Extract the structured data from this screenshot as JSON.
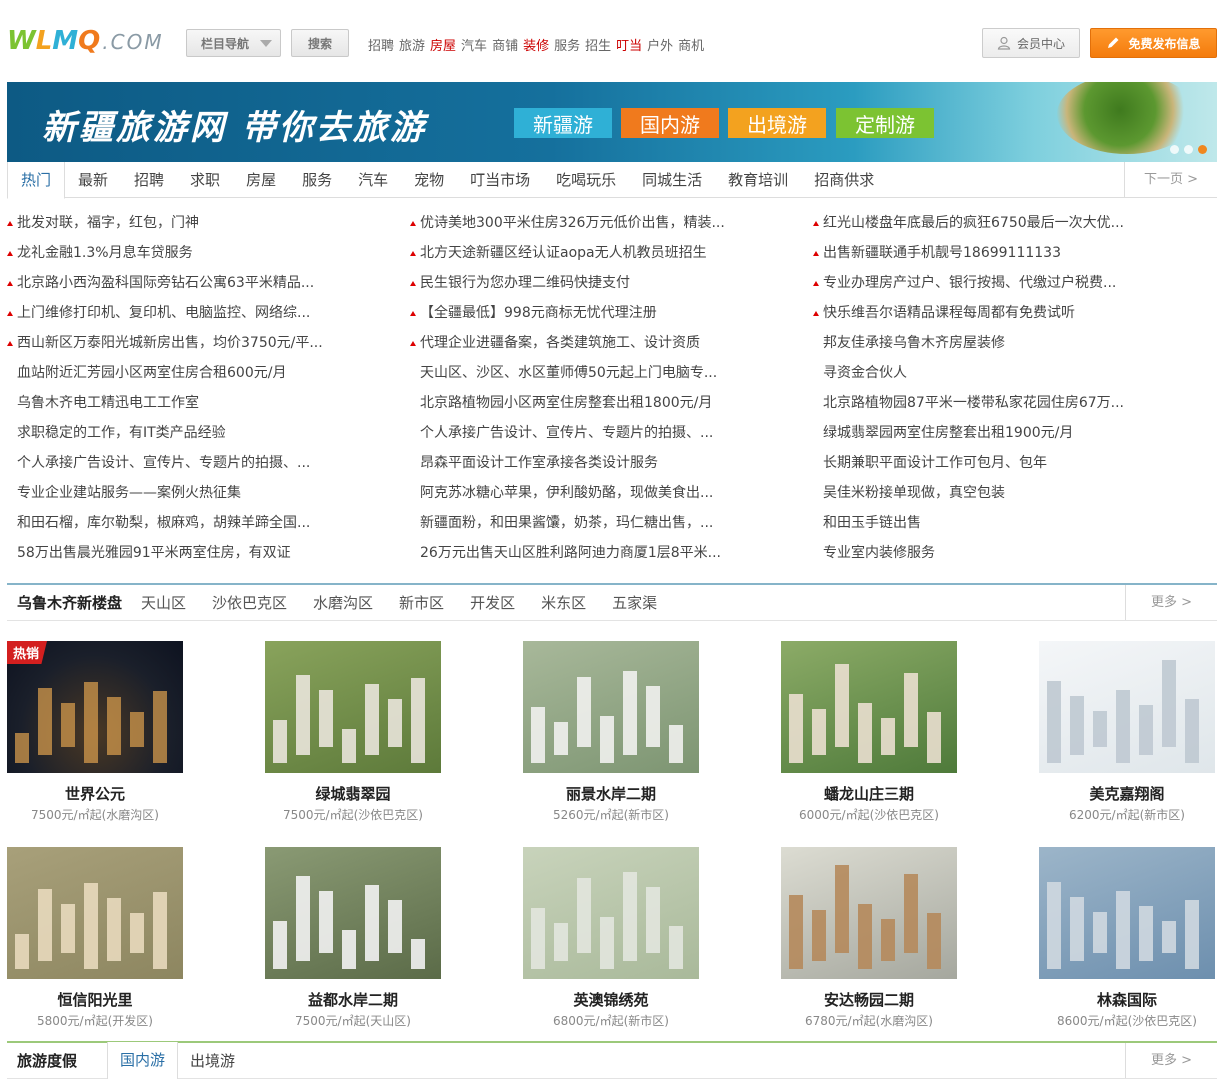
{
  "header": {
    "logo_letters": [
      "W",
      "L",
      "M",
      "Q"
    ],
    "logo_suffix": ".COM",
    "menu_label": "栏目导航",
    "search_label": "搜索",
    "quick_links": [
      {
        "text": "招聘",
        "hl": false
      },
      {
        "text": "旅游",
        "hl": false
      },
      {
        "text": "房屋",
        "hl": true
      },
      {
        "text": "汽车",
        "hl": false
      },
      {
        "text": "商铺",
        "hl": false
      },
      {
        "text": "装修",
        "hl": true
      },
      {
        "text": "服务",
        "hl": false
      },
      {
        "text": "招生",
        "hl": false
      },
      {
        "text": "叮当",
        "hl": true
      },
      {
        "text": "户外",
        "hl": false
      },
      {
        "text": "商机",
        "hl": false
      }
    ],
    "member_label": "会员中心",
    "publish_label": "免费发布信息"
  },
  "banner": {
    "slogan": "新疆旅游网 带你去旅游",
    "tags": [
      "新疆游",
      "国内游",
      "出境游",
      "定制游"
    ],
    "tag_colors": [
      "#2fb0d6",
      "#f07a1d",
      "#f3a21f",
      "#7cc332"
    ]
  },
  "category_tabs": [
    "热门",
    "最新",
    "招聘",
    "求职",
    "房屋",
    "服务",
    "汽车",
    "宠物",
    "叮当市场",
    "吃喝玩乐",
    "同城生活",
    "教育培训",
    "招商供求"
  ],
  "next_page": "下一页 >",
  "listings": [
    {
      "text": "批发对联，福字，红包，门神",
      "hot": true
    },
    {
      "text": "优诗美地300平米住房326万元低价出售，精装...",
      "hot": true
    },
    {
      "text": "红光山楼盘年底最后的疯狂6750最后一次大优...",
      "hot": true
    },
    {
      "text": "龙礼金融1.3%月息车贷服务",
      "hot": true
    },
    {
      "text": "北方天途新疆区经认证aopa无人机教员班招生",
      "hot": true
    },
    {
      "text": "出售新疆联通手机靓号18699111133",
      "hot": true
    },
    {
      "text": "北京路小西沟盈科国际旁钻石公寓63平米精品...",
      "hot": true
    },
    {
      "text": "民生银行为您办理二维码快捷支付",
      "hot": true
    },
    {
      "text": "专业办理房产过户、银行按揭、代缴过户税费...",
      "hot": true
    },
    {
      "text": "上门维修打印机、复印机、电脑监控、网络综...",
      "hot": true
    },
    {
      "text": "【全疆最低】998元商标无忧代理注册",
      "hot": true
    },
    {
      "text": "快乐维吾尔语精品课程每周都有免费试听",
      "hot": true
    },
    {
      "text": "西山新区万泰阳光城新房出售，均价3750元/平...",
      "hot": true
    },
    {
      "text": "代理企业进疆备案，各类建筑施工、设计资质",
      "hot": true
    },
    {
      "text": "邦友佳承接乌鲁木齐房屋装修",
      "hot": false
    },
    {
      "text": "血站附近汇芳园小区两室住房合租600元/月",
      "hot": false
    },
    {
      "text": "天山区、沙区、水区董师傅50元起上门电脑专...",
      "hot": false
    },
    {
      "text": "寻资金合伙人",
      "hot": false
    },
    {
      "text": "乌鲁木齐电工精迅电工工作室",
      "hot": false
    },
    {
      "text": "北京路植物园小区两室住房整套出租1800元/月",
      "hot": false
    },
    {
      "text": "北京路植物园87平米一楼带私家花园住房67万...",
      "hot": false
    },
    {
      "text": "求职稳定的工作，有IT类产品经验",
      "hot": false
    },
    {
      "text": "个人承接广告设计、宣传片、专题片的拍摄、...",
      "hot": false
    },
    {
      "text": "绿城翡翠园两室住房整套出租1900元/月",
      "hot": false
    },
    {
      "text": "个人承接广告设计、宣传片、专题片的拍摄、...",
      "hot": false
    },
    {
      "text": "昂森平面设计工作室承接各类设计服务",
      "hot": false
    },
    {
      "text": "长期兼职平面设计工作可包月、包年",
      "hot": false
    },
    {
      "text": "专业企业建站服务——案例火热征集",
      "hot": false
    },
    {
      "text": "阿克苏冰糖心苹果，伊利酸奶酪，现做美食出...",
      "hot": false
    },
    {
      "text": "吴佳米粉接单现做，真空包装",
      "hot": false
    },
    {
      "text": "和田石榴，库尔勒梨，椒麻鸡，胡辣羊蹄全国...",
      "hot": false
    },
    {
      "text": "新疆面粉，和田果酱馕，奶茶，玛仁糖出售，...",
      "hot": false
    },
    {
      "text": "和田玉手链出售",
      "hot": false
    },
    {
      "text": "58万出售晨光雅园91平米两室住房，有双证",
      "hot": false
    },
    {
      "text": "26万元出售天山区胜利路阿迪力商厦1层8平米...",
      "hot": false
    },
    {
      "text": "专业室内装修服务",
      "hot": false
    }
  ],
  "realestate": {
    "title": "乌鲁木齐新楼盘",
    "districts": [
      "天山区",
      "沙依巴克区",
      "水磨沟区",
      "新市区",
      "开发区",
      "米东区",
      "五家渠"
    ],
    "more": "更多 >",
    "hot_badge": "热销",
    "properties": [
      {
        "name": "世界公元",
        "price": "7500元/㎡起(水磨沟区)",
        "night": true
      },
      {
        "name": "绿城翡翠园",
        "price": "7500元/㎡起(沙依巴克区)",
        "night": false
      },
      {
        "name": "丽景水岸二期",
        "price": "5260元/㎡起(新市区)",
        "night": false
      },
      {
        "name": "蟠龙山庄三期",
        "price": "6000元/㎡起(沙依巴克区)",
        "night": false
      },
      {
        "name": "美克嘉翔阁",
        "price": "6200元/㎡起(新市区)",
        "night": false
      },
      {
        "name": "恒信阳光里",
        "price": "5800元/㎡起(开发区)",
        "night": false
      },
      {
        "name": "益都水岸二期",
        "price": "7500元/㎡起(天山区)",
        "night": false
      },
      {
        "name": "英澳锦绣苑",
        "price": "6800元/㎡起(新市区)",
        "night": false
      },
      {
        "name": "安达畅园二期",
        "price": "6780元/㎡起(水磨沟区)",
        "night": false
      },
      {
        "name": "林森国际",
        "price": "8600元/㎡起(沙依巴克区)",
        "night": false
      }
    ]
  },
  "travel": {
    "title": "旅游度假",
    "tabs": [
      "国内游",
      "出境游"
    ],
    "more": "更多 >"
  }
}
